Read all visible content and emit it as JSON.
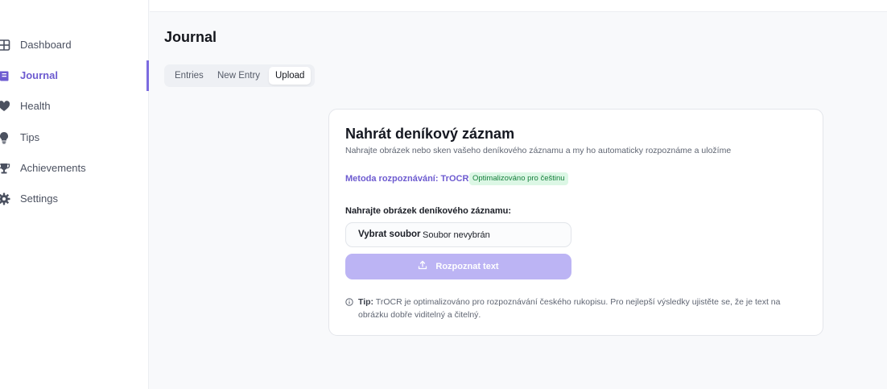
{
  "sidebar": {
    "items": [
      {
        "label": "Dashboard",
        "icon": "grid-icon",
        "active": false
      },
      {
        "label": "Journal",
        "icon": "book-icon",
        "active": true
      },
      {
        "label": "Health",
        "icon": "heart-icon",
        "active": false
      },
      {
        "label": "Tips",
        "icon": "lightbulb-icon",
        "active": false
      },
      {
        "label": "Achievements",
        "icon": "trophy-icon",
        "active": false
      },
      {
        "label": "Settings",
        "icon": "gear-icon",
        "active": false
      }
    ]
  },
  "page": {
    "title": "Journal"
  },
  "tabs": [
    {
      "label": "Entries",
      "active": false
    },
    {
      "label": "New Entry",
      "active": false
    },
    {
      "label": "Upload",
      "active": true
    }
  ],
  "upload_card": {
    "title": "Nahrát deníkový záznam",
    "subtitle": "Nahrajte obrázek nebo sken vašeho deníkového záznamu a my ho automaticky rozpoznáme a uložíme",
    "method_label": "Metoda rozpoznávání: TrOCR",
    "method_badge": "Optimalizováno pro češtinu",
    "field_label": "Nahrajte obrázek deníkového záznamu:",
    "file_button": "Vybrat soubor",
    "file_status": "Soubor nevybrán",
    "submit_label": "Rozpoznat text",
    "tip_prefix": "Tip:",
    "tip_text": "TrOCR je optimalizováno pro rozpoznávání českého rukopisu. Pro nejlepší výsledky ujistěte se, že je text na obrázku dobře viditelný a čitelný."
  },
  "colors": {
    "accent": "#7c6be0",
    "accent_text": "#6d5bd0",
    "button_disabled": "#bcb4f4",
    "badge_bg": "#dcf7e5",
    "badge_text": "#17803d"
  }
}
